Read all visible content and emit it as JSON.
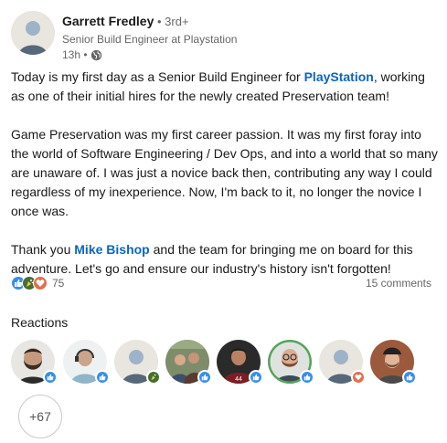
{
  "author": {
    "name": "Garrett Fredley",
    "degree": " • 3rd+",
    "headline": "Senior Build Engineer at Playstation",
    "time": "13h •",
    "visibility_icon": "globe-icon"
  },
  "post": {
    "p1_a": "Today is my first day as a Senior Build Engineer for ",
    "p1_mention": "PlayStation",
    "p1_b": ", working as one of their initial hires for the newly created Preservation team!",
    "p2": "Game Preservation was my first career passion. It was my first foray into the world of Software Engineering / Dev Ops, and into a world that so many are unaware of. I was just a novice back then, contributing any way I could regardless of my inexperience. Now, I'm back to it, no longer the novice I once was.",
    "p3_a": "Thank you ",
    "p3_mention": "Mike Bishop",
    "p3_b": " and the team for bringing me on board for this adventure. Let's go and ensure our industry's history isn't forgotten!"
  },
  "social": {
    "reaction_icons": [
      "like-icon",
      "celebrate-icon",
      "love-icon"
    ],
    "reaction_count": "75",
    "comments": "15 comments"
  },
  "reactions": {
    "title": "Reactions",
    "people": [
      {
        "avatar": "bearded-man-avatar",
        "badge": "like-icon"
      },
      {
        "avatar": "man-headset-avatar",
        "badge": "like-icon"
      },
      {
        "avatar": "default-avatar",
        "badge": "celebrate-icon"
      },
      {
        "avatar": "group-photo-avatar",
        "badge": "like-icon"
      },
      {
        "avatar": "man-jersey-avatar",
        "badge": "like-icon"
      },
      {
        "avatar": "man-glasses-avatar",
        "badge": "like-icon"
      },
      {
        "avatar": "default-avatar",
        "badge": "love-icon"
      },
      {
        "avatar": "man-hat-avatar",
        "badge": "like-icon"
      }
    ],
    "more": "+67"
  },
  "colors": {
    "link_blue": "#0a66c2",
    "like_blue": "#378fe9",
    "celebrate_green": "#44712e",
    "love_red": "#df704d"
  }
}
